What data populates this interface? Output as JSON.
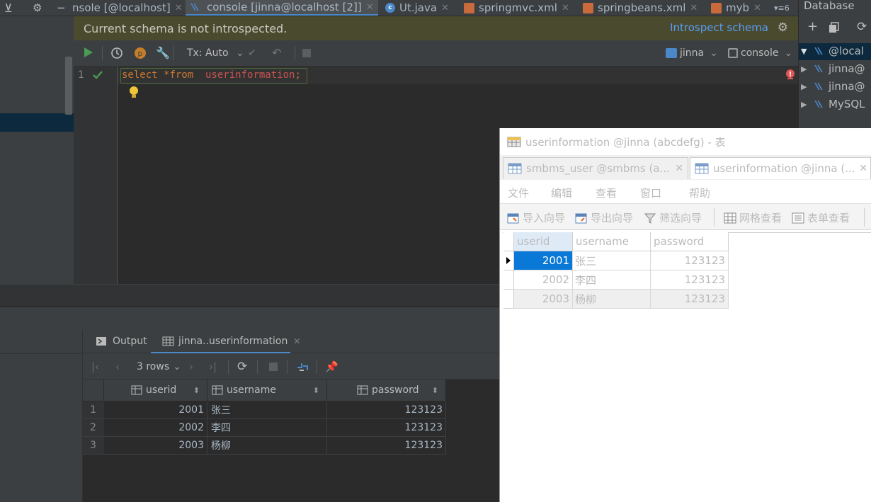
{
  "tabs": [
    {
      "label": "nsole [@localhost]"
    },
    {
      "label": "console [jinna@localhost [2]]"
    },
    {
      "label": "Ut.java"
    },
    {
      "label": "springmvc.xml"
    },
    {
      "label": "springbeans.xml"
    },
    {
      "label": "myb"
    },
    {
      "label": "▾≡6"
    }
  ],
  "banner": {
    "text": "Current schema is not introspected.",
    "action": "Introspect schema"
  },
  "toolbar": {
    "tx": "Tx: Auto",
    "schema": "jinna",
    "session": "console"
  },
  "editor": {
    "line_number": "1",
    "code": [
      {
        "text": "select *",
        "cls": "kw"
      },
      {
        "text": "from",
        "cls": "kw"
      },
      {
        "text": "  "
      },
      {
        "text": "userinformation",
        "cls": "tbl"
      },
      {
        "text": ";",
        "cls": "kw"
      }
    ]
  },
  "results": {
    "tabs": {
      "output": "Output",
      "table": "jinna..userinformation"
    },
    "rows_label": "3 rows",
    "columns": [
      "userid",
      "username",
      "password"
    ],
    "rows": [
      {
        "n": "1",
        "userid": "2001",
        "username": "张三",
        "password": "123123"
      },
      {
        "n": "2",
        "userid": "2002",
        "username": "李四",
        "password": "123123"
      },
      {
        "n": "3",
        "userid": "2003",
        "username": "杨柳",
        "password": "123123"
      }
    ]
  },
  "database_panel": {
    "title": "Database",
    "tree": [
      {
        "label": "@local",
        "expanded": true
      },
      {
        "label": "jinna@"
      },
      {
        "label": "jinna@"
      },
      {
        "label": "MySQL"
      }
    ]
  },
  "navicat": {
    "title": "userinformation @jinna (abcdefg) - 表",
    "tabs": [
      "smbms_user @smbms (a...",
      "userinformation @jinna (..."
    ],
    "menu": [
      "文件",
      "编辑",
      "查看",
      "窗口",
      "帮助"
    ],
    "toolbar": [
      "导入向导",
      "导出向导",
      "筛选向导",
      "网格查看",
      "表单查看"
    ],
    "columns": [
      "userid",
      "username",
      "password"
    ],
    "rows": [
      {
        "userid": "2001",
        "username": "张三",
        "password": "123123"
      },
      {
        "userid": "2002",
        "username": "李四",
        "password": "123123"
      },
      {
        "userid": "2003",
        "username": "杨柳",
        "password": "123123"
      }
    ]
  },
  "colors": {
    "accent": "#4a88c7",
    "run": "#499c54",
    "keyword": "#cc7832",
    "table": "#c75450",
    "banner_bg": "#4a4a2e"
  }
}
